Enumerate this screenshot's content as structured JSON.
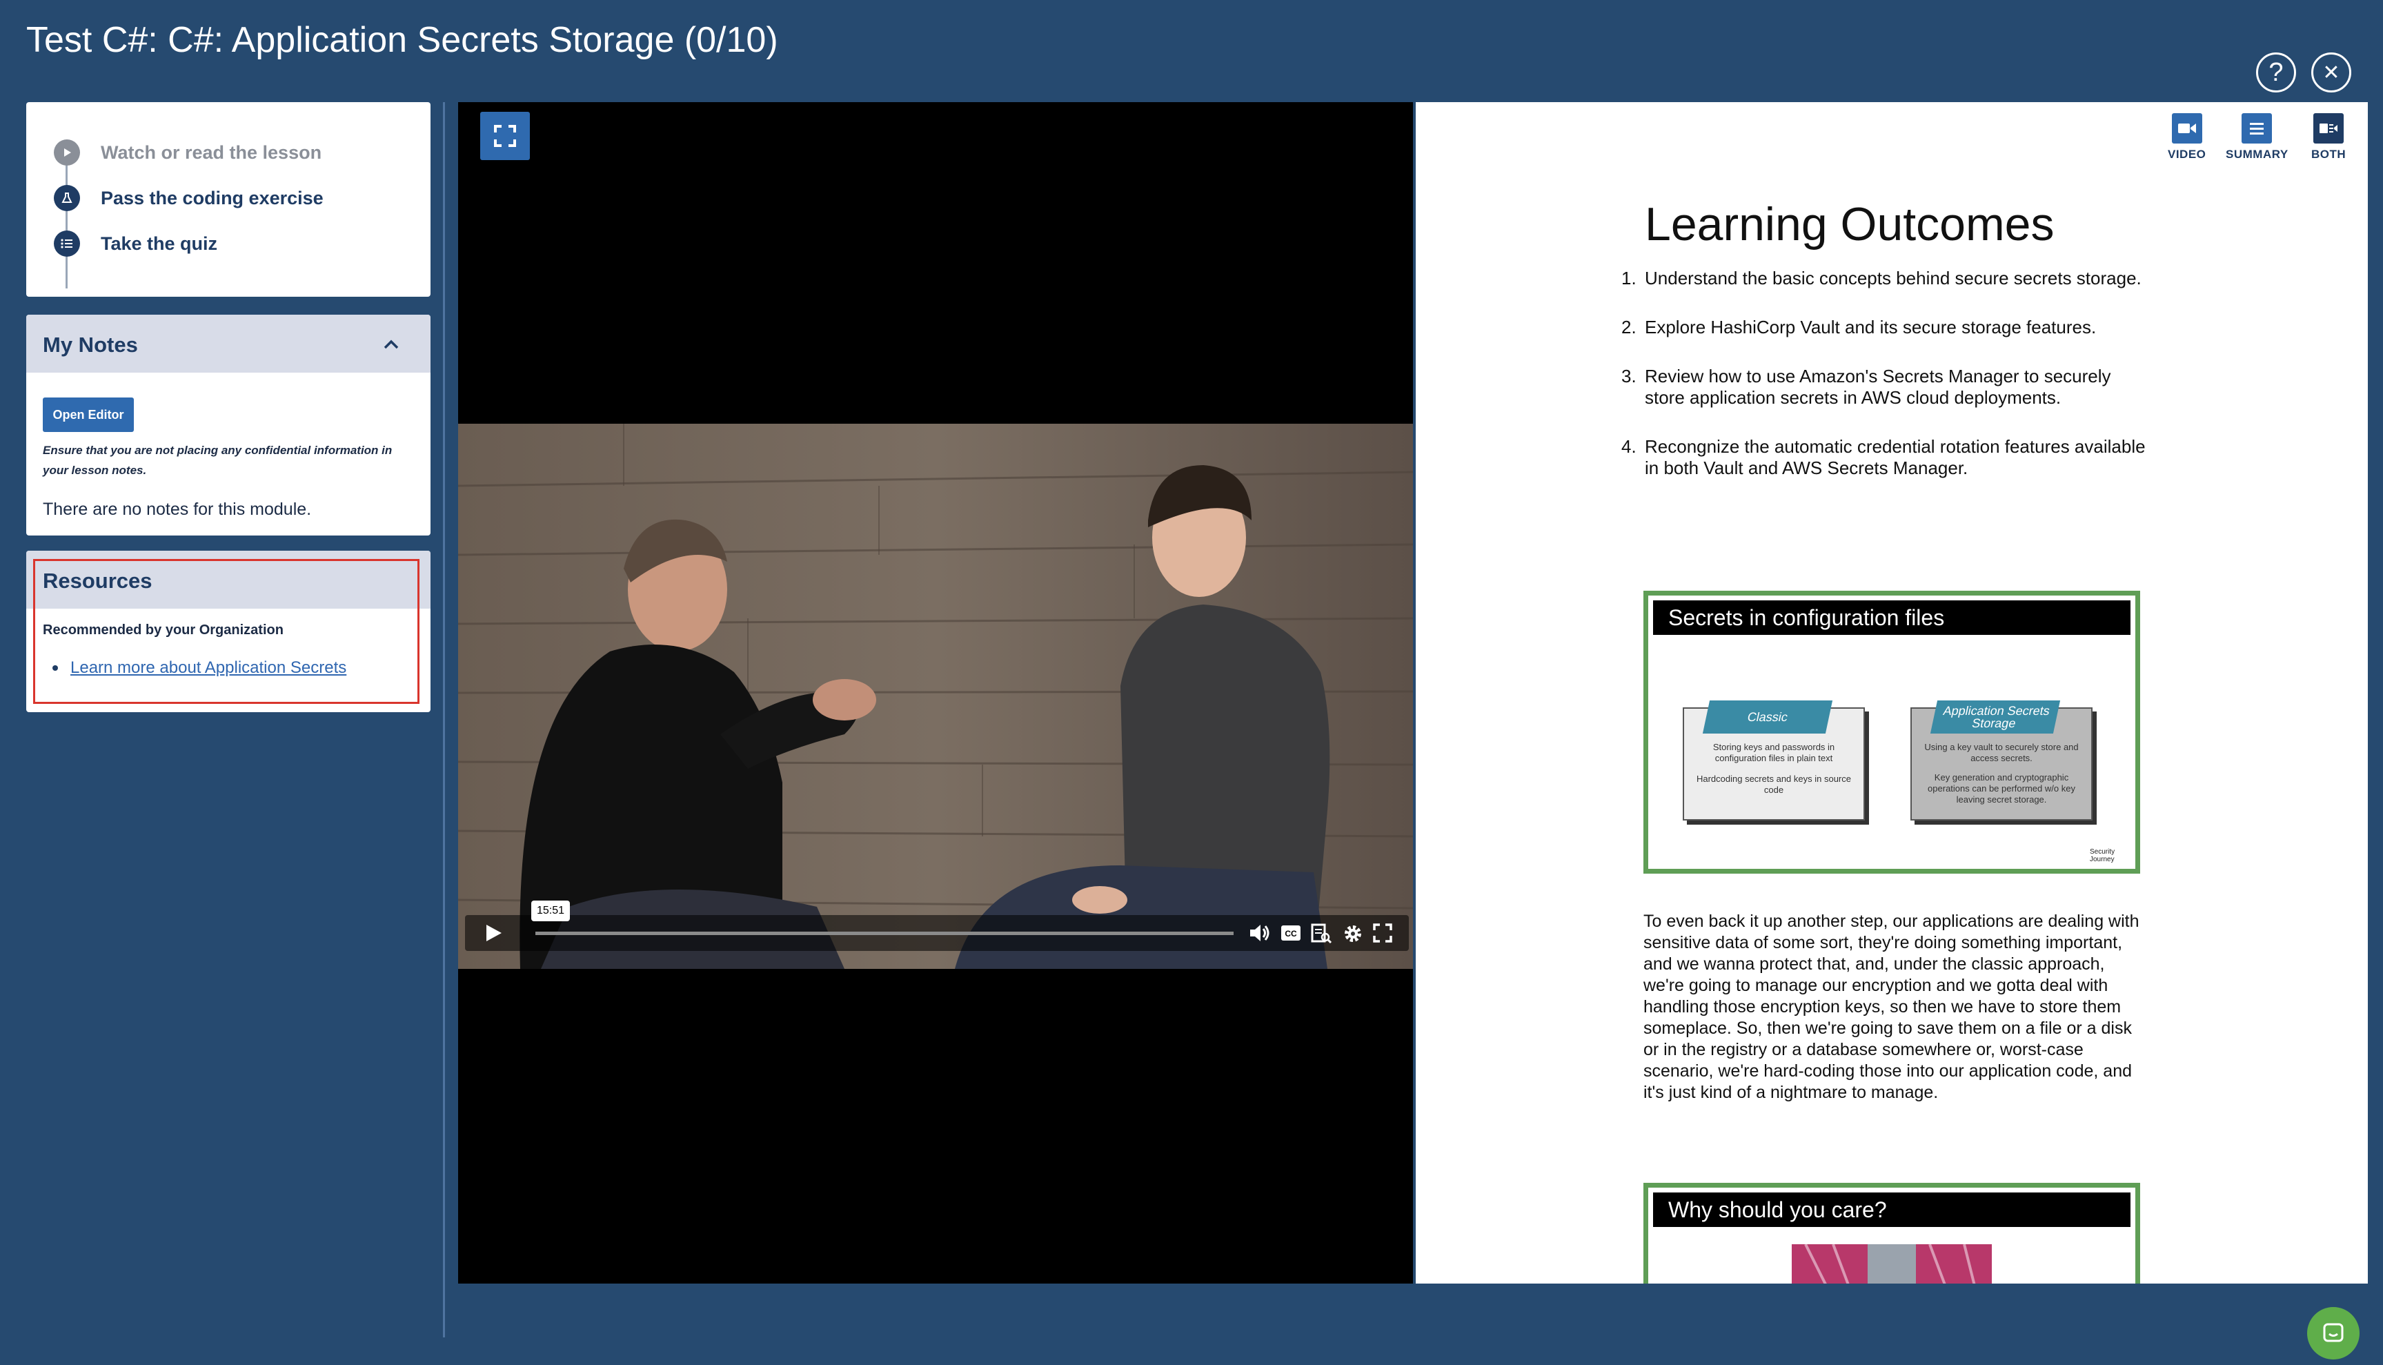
{
  "header": {
    "title": "Test C#: C#: Application Secrets Storage (0/10)",
    "help_label": "?",
    "close_label": "✕"
  },
  "steps": [
    {
      "label": "Watch or read the lesson",
      "color": "#8a8f98",
      "icon": "play-circle-icon"
    },
    {
      "label": "Pass the coding exercise",
      "color": "#1f3c64",
      "icon": "flask-icon"
    },
    {
      "label": "Take the quiz",
      "color": "#1f3c64",
      "icon": "list-icon"
    }
  ],
  "notes": {
    "title": "My Notes",
    "open_editor": "Open Editor",
    "warning": "Ensure that you are not placing any confidential information in your lesson notes.",
    "empty": "There are no notes for this module."
  },
  "resources": {
    "title": "Resources",
    "subtitle": "Recommended by your Organization",
    "link": "Learn more about Application Secrets"
  },
  "video": {
    "time_tooltip": "15:51",
    "progress": 0.0
  },
  "view_modes": [
    {
      "label": "VIDEO",
      "icon": "video-icon"
    },
    {
      "label": "SUMMARY",
      "icon": "summary-icon"
    },
    {
      "label": "BOTH",
      "icon": "both-icon"
    }
  ],
  "summary": {
    "title": "Learning Outcomes",
    "outcomes": [
      "Understand the basic concepts behind secure secrets storage.",
      "Explore HashiCorp Vault and its secure storage features.",
      "Review how to use Amazon's Secrets Manager to securely store application secrets in AWS cloud deployments.",
      "Recongnize the automatic credential rotation features available in both Vault and AWS Secrets Manager."
    ],
    "slide1": {
      "title": "Secrets in configuration files",
      "card1_tag": "Classic",
      "card1_text1": "Storing keys and passwords in configuration files in plain text",
      "card1_text2": "Hardcoding secrets and keys in source code",
      "card2_tag": "Application Secrets Storage",
      "card2_text1": "Using a key vault to securely store and access secrets.",
      "card2_text2": "Key generation and cryptographic operations can be performed w/o key leaving secret storage.",
      "logo": "Security Journey"
    },
    "transcript": "To even back it up another step, our applications are dealing with sensitive data of some sort, they're doing something important, and we wanna protect that, and, under the classic approach, we're going to manage our encryption and we gotta deal with handling those encryption keys, so then we have to store them someplace. So, then we're going to save them on a file or a disk or in the registry or a database somewhere or, worst-case scenario, we're hard-coding those into our application code, and it's just kind of a nightmare to manage.",
    "slide2": {
      "title": "Why should you care?"
    }
  },
  "colors": {
    "background": "#264a70",
    "accent": "#2f6aaf",
    "slide_border": "#5f9e56",
    "highlight": "#d9352d",
    "chat": "#5fae4a"
  }
}
